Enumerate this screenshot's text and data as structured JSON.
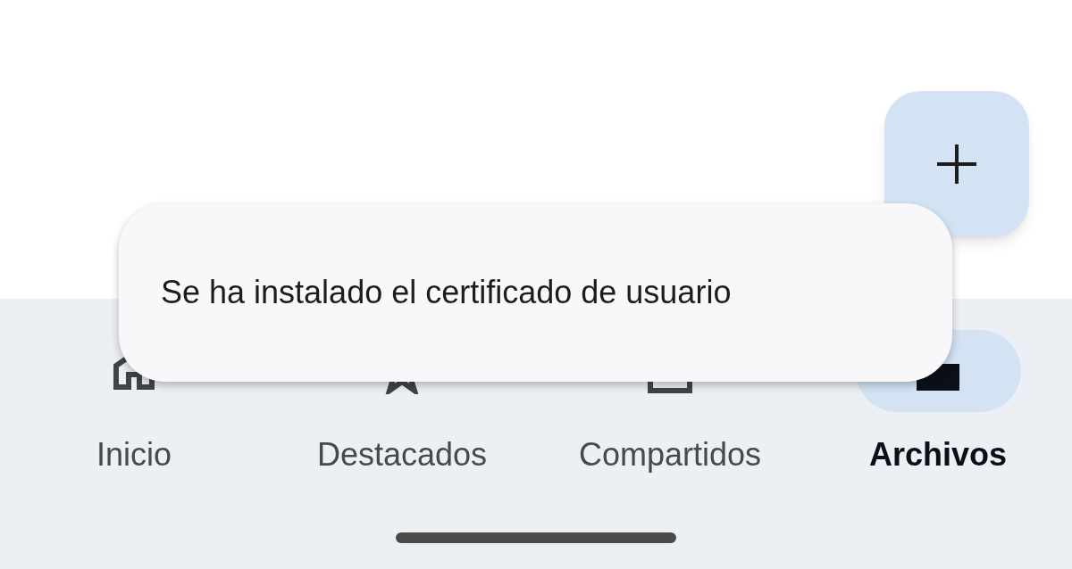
{
  "fab": {
    "kind": "add"
  },
  "nav": [
    {
      "label": "Inicio",
      "kind": "home",
      "selected": false
    },
    {
      "label": "Destacados",
      "kind": "star",
      "selected": false
    },
    {
      "label": "Compartidos",
      "kind": "shared",
      "selected": false
    },
    {
      "label": "Archivos",
      "kind": "folder",
      "selected": true
    }
  ],
  "snackbar": {
    "message": "Se ha instalado el certificado de usuario"
  }
}
